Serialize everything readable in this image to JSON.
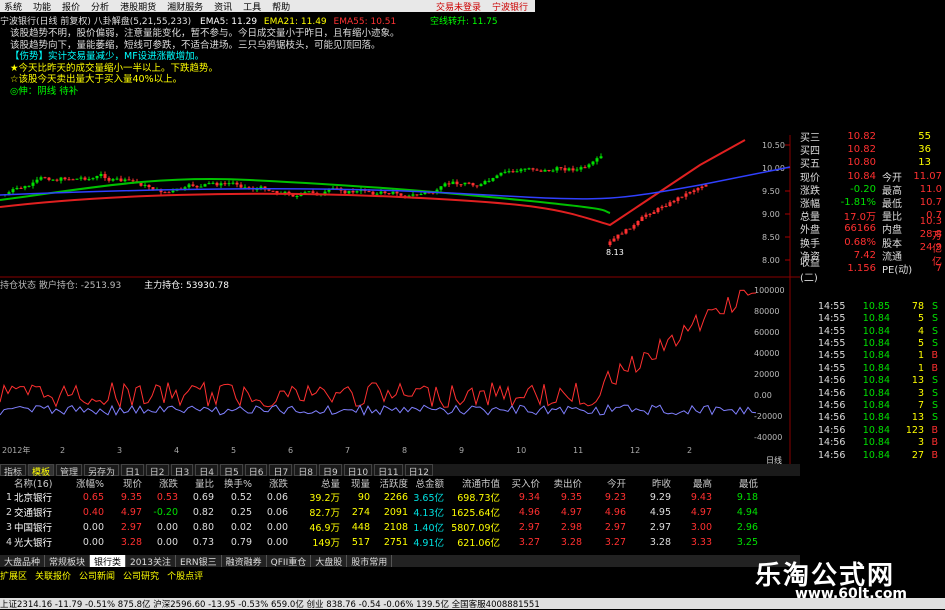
{
  "menubar": {
    "items": [
      "系统",
      "功能",
      "报价",
      "分析",
      "港股期货",
      "湘财服务",
      "资讯",
      "工具",
      "帮助"
    ],
    "right_status": "交易未登录",
    "right_app": "宁波银行"
  },
  "topinfo": {
    "title": "宁波银行(日线 前复权) 八卦解盘(5,21,55,233)",
    "ema5": "EMA5: 11.29",
    "ema21": "EMA21: 11.49",
    "ema55": "EMA55: 10.51",
    "right": "空线转升: 11.75"
  },
  "annotations": [
    "该股趋势不明，股价偏弱，注意量能变化，暂不参与。今日成交量小于昨日，且有缩小迹象。",
    "该股趋势向下，量能萎缩，短线可参跌，不适合进场。三只乌鸦锯枝头，可能见顶回落。",
    "【伤势】实计交易量减少，MF设进涨散增加。",
    "★今天比昨天的成交量缩小一半以上。下跌趋势。",
    "☆该股今天卖出量大于买入量40%以上。",
    "◎伸：阴线 待补"
  ],
  "midlabel": {
    "left": "持仓状态  散户持仓: -2513.93",
    "right": "主力持仓: 53930.78"
  },
  "chart_labels": {
    "low_marker": "8.13",
    "price_ticks": [
      "10.50",
      "10.00",
      "9.50",
      "9.00",
      "8.50",
      "8.00"
    ],
    "ind_ticks": [
      "100000",
      "80000",
      "60000",
      "40000",
      "20000",
      "0.00",
      "-20000",
      "-40000"
    ],
    "time_start": "2012年",
    "time_marks": [
      "2",
      "3",
      "4",
      "5",
      "6",
      "7",
      "8",
      "9",
      "10",
      "11",
      "12",
      "2"
    ],
    "right_tag": "日线"
  },
  "quote": {
    "rows": [
      {
        "label": "买三",
        "price": "10.82",
        "vol": "55"
      },
      {
        "label": "买四",
        "price": "10.82",
        "vol": "36"
      },
      {
        "label": "买五",
        "price": "10.80",
        "vol": "13"
      },
      {
        "label": "现价",
        "price": "10.84",
        "l2": "今开",
        "v2": "11.07"
      },
      {
        "label": "涨跌",
        "price": "-0.20",
        "l2": "最高",
        "v2": "11.0"
      },
      {
        "label": "涨幅",
        "price": "-1.81%",
        "l2": "最低",
        "v2": "10.7"
      },
      {
        "label": "总量",
        "price": "17.0万",
        "l2": "量比",
        "v2": "0.7"
      },
      {
        "label": "外盘",
        "price": "66166",
        "l2": "内盘",
        "v2": "10.3万"
      },
      {
        "label": "换手",
        "price": "0.68%",
        "l2": "股本",
        "v2": "28.8亿"
      },
      {
        "label": "净资",
        "price": "7.42",
        "l2": "流通",
        "v2": "24.9亿"
      },
      {
        "label": "收益(二)",
        "price": "1.156",
        "l2": "PE(动)",
        "v2": "7"
      }
    ]
  },
  "ticks": [
    {
      "t": "14:55",
      "p": "10.85",
      "v": "78",
      "s": "S"
    },
    {
      "t": "14:55",
      "p": "10.84",
      "v": "5",
      "s": "S"
    },
    {
      "t": "14:55",
      "p": "10.84",
      "v": "4",
      "s": "S"
    },
    {
      "t": "14:55",
      "p": "10.84",
      "v": "5",
      "s": "S"
    },
    {
      "t": "14:55",
      "p": "10.84",
      "v": "1",
      "s": "B"
    },
    {
      "t": "14:55",
      "p": "10.84",
      "v": "1",
      "s": "B"
    },
    {
      "t": "14:56",
      "p": "10.84",
      "v": "13",
      "s": "S"
    },
    {
      "t": "14:56",
      "p": "10.84",
      "v": "3",
      "s": "S"
    },
    {
      "t": "14:56",
      "p": "10.84",
      "v": "7",
      "s": "S"
    },
    {
      "t": "14:56",
      "p": "10.84",
      "v": "13",
      "s": "S"
    },
    {
      "t": "14:56",
      "p": "10.84",
      "v": "123",
      "s": "B"
    },
    {
      "t": "14:56",
      "p": "10.84",
      "v": "3",
      "s": "B"
    },
    {
      "t": "14:56",
      "p": "10.84",
      "v": "27",
      "s": "B"
    }
  ],
  "tabs1": [
    "指标",
    "模板",
    "管理",
    "另存为",
    "日1",
    "日2",
    "日3",
    "日4",
    "日5",
    "日6",
    "日7",
    "日8",
    "日9",
    "日10",
    "日11",
    "日12"
  ],
  "table": {
    "headers": [
      "",
      "名称(16)",
      "涨幅%",
      "现价",
      "涨跌",
      "量比",
      "换手%",
      "涨跌",
      "总量",
      "现量",
      "活跃度",
      "总金额",
      "流通市值",
      "买入价",
      "卖出价",
      "今开",
      "昨收",
      "最高",
      "最低"
    ],
    "rows": [
      {
        "n": "1",
        "name": "北京银行",
        "zf": "0.65",
        "xj": "9.35",
        "zd": "0.53",
        "lb": "0.69",
        "hs": "0.52",
        "zs": "0.06",
        "zl": "39.2万",
        "xl": "90",
        "hyd": "2266",
        "zje": "3.65亿",
        "ltsz": "698.73亿",
        "mr": "9.34",
        "mc": "9.35",
        "jk": "9.23",
        "zsp": "9.29",
        "zg": "9.43",
        "zd2": "9.18"
      },
      {
        "n": "2",
        "name": "交通银行",
        "zf": "0.40",
        "xj": "4.97",
        "zd": "-0.20",
        "lb": "0.82",
        "hs": "0.25",
        "zs": "0.06",
        "zl": "82.7万",
        "xl": "274",
        "hyd": "2091",
        "zje": "4.13亿",
        "ltsz": "1625.64亿",
        "mr": "4.96",
        "mc": "4.97",
        "jk": "4.96",
        "zsp": "4.95",
        "zg": "4.97",
        "zd2": "4.94"
      },
      {
        "n": "3",
        "name": "中国银行",
        "zf": "0.00",
        "xj": "2.97",
        "zd": "0.00",
        "lb": "0.80",
        "hs": "0.02",
        "zs": "0.00",
        "zl": "46.9万",
        "xl": "448",
        "hyd": "2108",
        "zje": "1.40亿",
        "ltsz": "5807.09亿",
        "mr": "2.97",
        "mc": "2.98",
        "jk": "2.97",
        "zsp": "2.97",
        "zg": "3.00",
        "zd2": "2.96"
      },
      {
        "n": "4",
        "name": "光大银行",
        "zf": "0.00",
        "xj": "3.28",
        "zd": "0.00",
        "lb": "0.73",
        "hs": "0.79",
        "zs": "0.00",
        "zl": "149万",
        "xl": "517",
        "hyd": "2751",
        "zje": "4.91亿",
        "ltsz": "621.06亿",
        "mr": "3.27",
        "mc": "3.28",
        "jk": "3.27",
        "zsp": "3.28",
        "zg": "3.33",
        "zd2": "3.25"
      }
    ]
  },
  "tabs2": [
    "大盘品种",
    "常规板块",
    "银行类",
    "2013关注",
    "ERN银三",
    "融资融券",
    "QFII重仓",
    "大盘股",
    "股市常用"
  ],
  "tabs3": [
    "扩展区",
    "关联报价",
    "公司新闻",
    "公司研究",
    "个股点评"
  ],
  "status": "上证2314.16 -11.79 -0.51% 875.8亿  沪深2596.60 -13.95 -0.53% 659.0亿  创业 838.76 -0.54 -0.06% 139.5亿        全国客服4008881551",
  "watermark": {
    "title": "乐淘公式网",
    "url": "www.60lt.com"
  },
  "colors": {
    "up": "#ff3030",
    "down": "#00e000",
    "ema_green": "#00c000",
    "ema_red": "#e02020",
    "ema_blue": "#3040ff"
  }
}
